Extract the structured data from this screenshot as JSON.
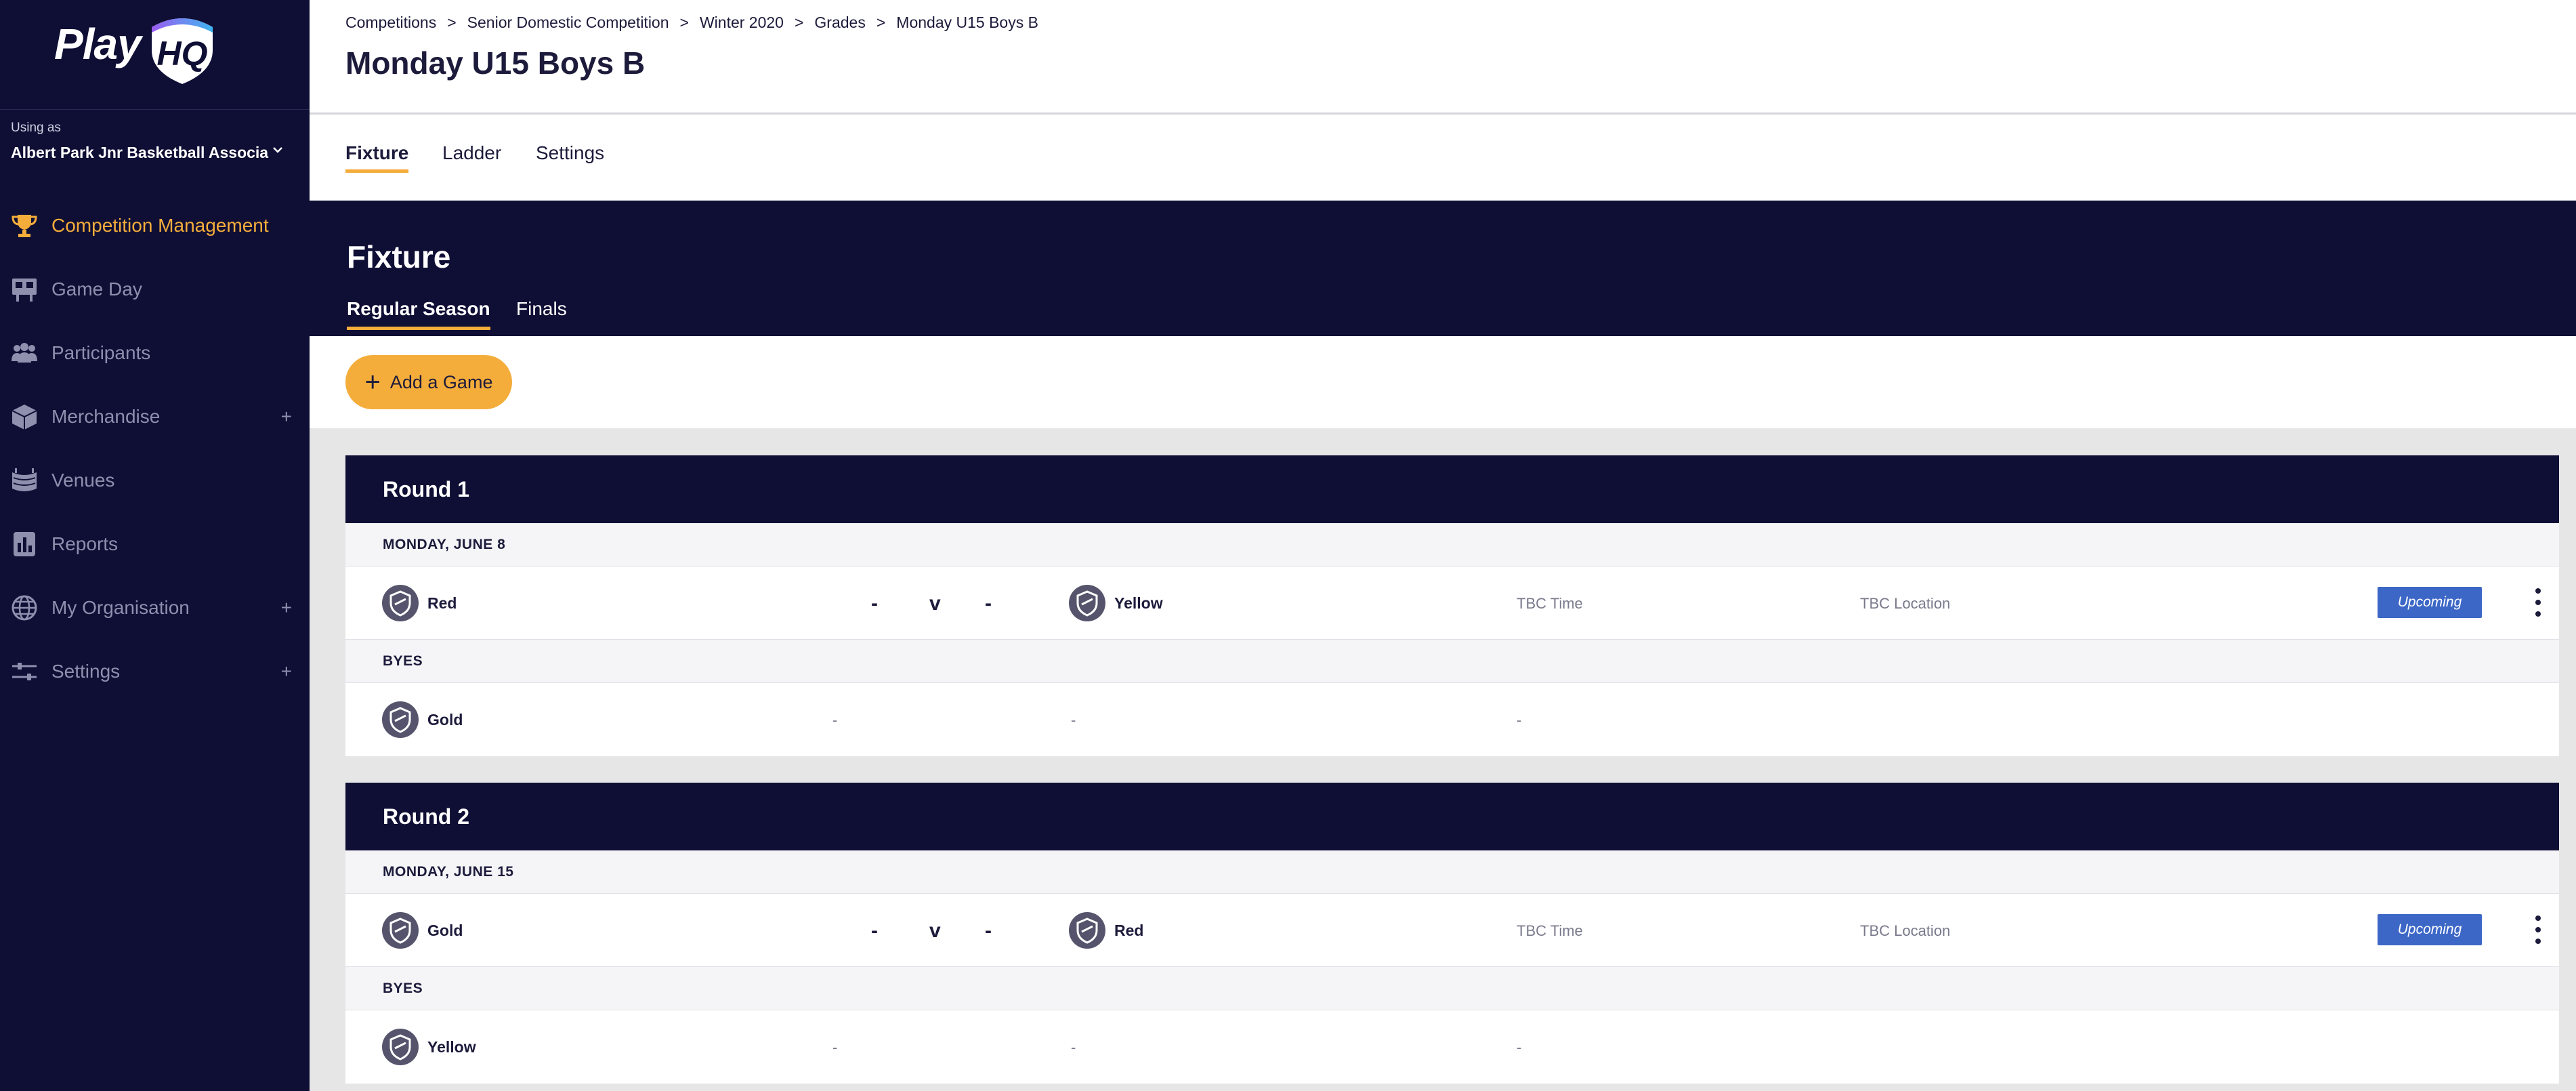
{
  "sidebar": {
    "logo": "Play",
    "using_as_caption": "Using as",
    "org_name": "Albert Park Jnr Basketball Associa",
    "items": [
      {
        "label": "Competition Management",
        "icon": "trophy-icon",
        "active": true,
        "expandable": false
      },
      {
        "label": "Game Day",
        "icon": "scoreboard-icon",
        "active": false,
        "expandable": false
      },
      {
        "label": "Participants",
        "icon": "people-icon",
        "active": false,
        "expandable": false
      },
      {
        "label": "Merchandise",
        "icon": "box-icon",
        "active": false,
        "expandable": true
      },
      {
        "label": "Venues",
        "icon": "stadium-icon",
        "active": false,
        "expandable": false
      },
      {
        "label": "Reports",
        "icon": "reports-icon",
        "active": false,
        "expandable": false
      },
      {
        "label": "My Organisation",
        "icon": "globe-icon",
        "active": false,
        "expandable": true
      },
      {
        "label": "Settings",
        "icon": "sliders-icon",
        "active": false,
        "expandable": true
      }
    ],
    "plus": "+"
  },
  "header": {
    "breadcrumb": [
      "Competitions",
      "Senior Domestic Competition",
      "Winter 2020",
      "Grades",
      "Monday U15 Boys B"
    ],
    "separator": ">",
    "title": "Monday U15 Boys B"
  },
  "subnav": {
    "tabs": [
      {
        "label": "Fixture",
        "active": true
      },
      {
        "label": "Ladder",
        "active": false
      },
      {
        "label": "Settings",
        "active": false
      }
    ]
  },
  "fixture": {
    "title": "Fixture",
    "tabs": [
      {
        "label": "Regular Season",
        "active": true
      },
      {
        "label": "Finals",
        "active": false
      }
    ],
    "add_game_label": "Add a Game"
  },
  "rounds": [
    {
      "title": "Round 1",
      "day": "MONDAY, JUNE 8",
      "game": {
        "home": "Red",
        "home_score": "-",
        "vs": "v",
        "away_score": "-",
        "away": "Yellow",
        "time": "TBC Time",
        "location": "TBC Location",
        "status": "Upcoming"
      },
      "byes_label": "BYES",
      "bye": {
        "team": "Gold",
        "dash1": "-",
        "dash2": "-",
        "dash3": "-"
      }
    },
    {
      "title": "Round 2",
      "day": "MONDAY, JUNE 15",
      "game": {
        "home": "Gold",
        "home_score": "-",
        "vs": "v",
        "away_score": "-",
        "away": "Red",
        "time": "TBC Time",
        "location": "TBC Location",
        "status": "Upcoming"
      },
      "byes_label": "BYES",
      "bye": {
        "team": "Yellow",
        "dash1": "-",
        "dash2": "-",
        "dash3": "-"
      }
    }
  ],
  "colors": {
    "navy": "#0f0e35",
    "accent": "#f4ad3b",
    "status_blue": "#3c67c6"
  }
}
